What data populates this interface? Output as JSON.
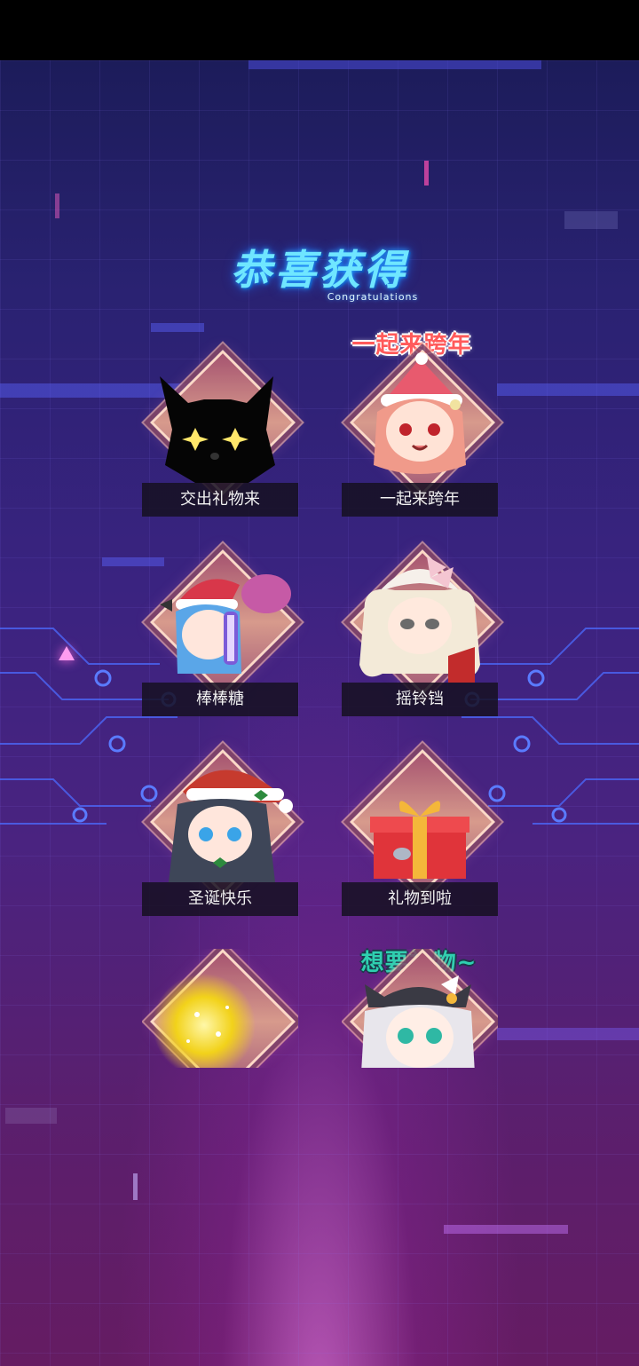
{
  "header": {
    "title": "恭喜获得",
    "subtitle": "Congratulations"
  },
  "items": [
    {
      "label": "交出礼物来",
      "icon": "black-cat-silhouette-icon"
    },
    {
      "label": "一起来跨年",
      "icon": "santa-hat-girl-icon",
      "callout": "一起来跨年"
    },
    {
      "label": "棒棒糖",
      "icon": "lollipop-girl-icon"
    },
    {
      "label": "摇铃铛",
      "icon": "bell-girl-icon"
    },
    {
      "label": "圣诞快乐",
      "icon": "christmas-girl-icon"
    },
    {
      "label": "礼物到啦",
      "icon": "gift-box-icon"
    },
    {
      "label": "",
      "icon": "golden-sparkle-icon"
    },
    {
      "label": "",
      "icon": "cat-hat-girl-icon",
      "callout": "想要礼物~"
    }
  ],
  "colors": {
    "title": "#6fe6ff",
    "label_bg": "#16102a",
    "diamond": "#d79a8c",
    "callout_red": "#ff5a5a",
    "callout_teal": "#2ed0b0"
  }
}
